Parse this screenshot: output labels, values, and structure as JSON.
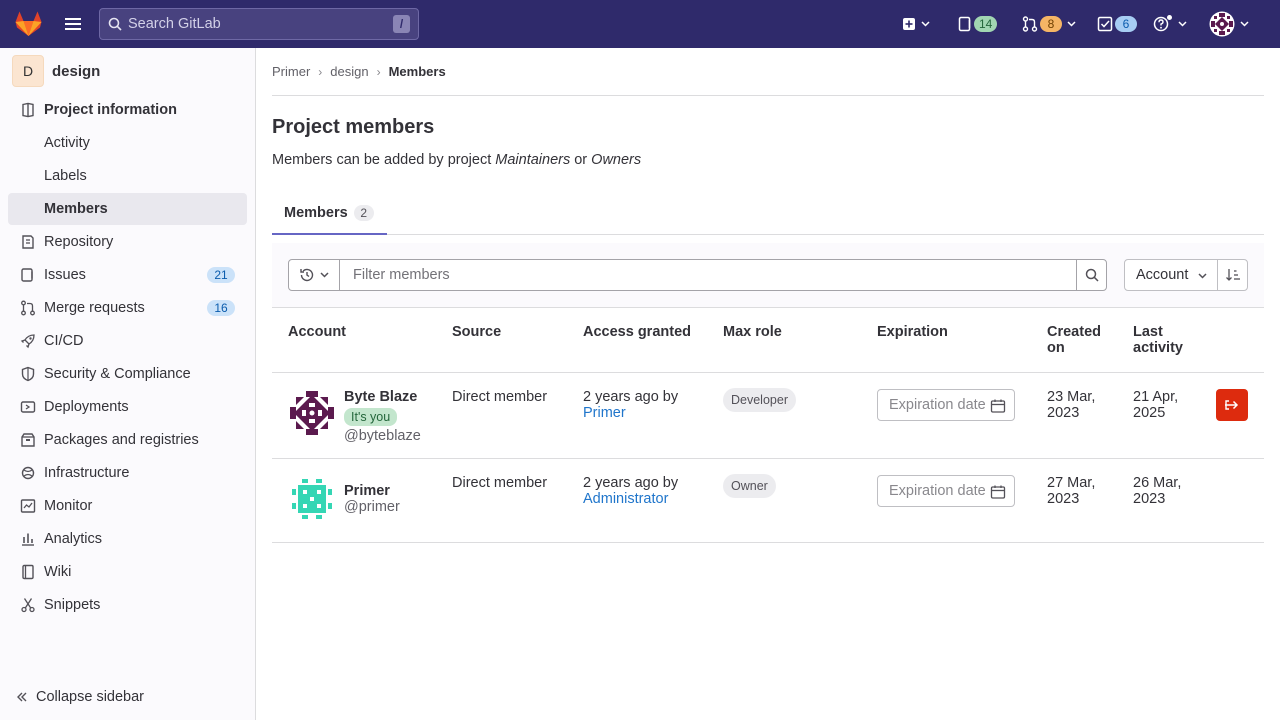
{
  "topbar": {
    "search_placeholder": "Search GitLab",
    "search_shortcut": "/",
    "issues_count": "14",
    "merge_requests_count": "8",
    "todos_count": "6"
  },
  "sidebar": {
    "project_initial": "D",
    "project_name": "design",
    "items": [
      {
        "label": "Project information",
        "icon": "project-info-icon"
      },
      {
        "label": "Activity"
      },
      {
        "label": "Labels"
      },
      {
        "label": "Members"
      },
      {
        "label": "Repository",
        "icon": "repository-icon"
      },
      {
        "label": "Issues",
        "icon": "issues-icon",
        "count": "21"
      },
      {
        "label": "Merge requests",
        "icon": "merge-request-icon",
        "count": "16"
      },
      {
        "label": "CI/CD",
        "icon": "rocket-icon"
      },
      {
        "label": "Security & Compliance",
        "icon": "shield-icon"
      },
      {
        "label": "Deployments",
        "icon": "deployments-icon"
      },
      {
        "label": "Packages and registries",
        "icon": "package-icon"
      },
      {
        "label": "Infrastructure",
        "icon": "infrastructure-icon"
      },
      {
        "label": "Monitor",
        "icon": "monitor-icon"
      },
      {
        "label": "Analytics",
        "icon": "analytics-icon"
      },
      {
        "label": "Wiki",
        "icon": "book-icon"
      },
      {
        "label": "Snippets",
        "icon": "snippet-icon"
      }
    ],
    "collapse_label": "Collapse sidebar"
  },
  "breadcrumb": {
    "items": [
      "Primer",
      "design",
      "Members"
    ]
  },
  "page": {
    "title": "Project members",
    "desc_prefix": "Members can be added by project ",
    "desc_role1": "Maintainers",
    "desc_mid": " or ",
    "desc_role2": "Owners"
  },
  "tabs": [
    {
      "label": "Members",
      "count": "2"
    }
  ],
  "filter": {
    "placeholder": "Filter members",
    "sort_label": "Account"
  },
  "table": {
    "headers": [
      "Account",
      "Source",
      "Access granted",
      "Max role",
      "Expiration",
      "Created on",
      "Last activity"
    ],
    "rows": [
      {
        "name": "Byte Blaze",
        "you_badge": "It's you",
        "handle": "@byteblaze",
        "source": "Direct member",
        "access_granted": "2 years ago by",
        "granted_by": "Primer",
        "max_role": "Developer",
        "expiration_placeholder": "Expiration date",
        "created_on": "23 Mar, 2023",
        "last_activity": "21 Apr, 2025"
      },
      {
        "name": "Primer",
        "handle": "@primer",
        "source": "Direct member",
        "access_granted": "2 years ago by",
        "granted_by": "Administrator",
        "max_role": "Owner",
        "expiration_placeholder": "Expiration date",
        "created_on": "27 Mar, 2023",
        "last_activity": "26 Mar, 2023"
      }
    ]
  },
  "colors": {
    "topbar": "#2f2a6b",
    "link": "#1f75cb",
    "danger": "#dd2b0e",
    "tab_underline": "#6666c4"
  }
}
